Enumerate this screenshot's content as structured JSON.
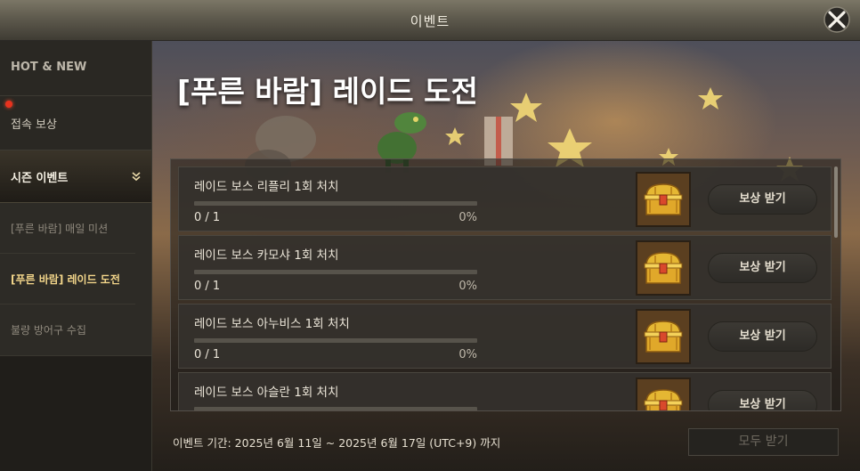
{
  "window": {
    "title": "이벤트"
  },
  "sidebar": {
    "hot_new": "HOT & NEW",
    "login_reward": "접속 보상",
    "season_event": "시즌 이벤트",
    "sub_items": [
      {
        "label": "[푸른 바람] 매일 미션",
        "active": false
      },
      {
        "label": "[푸른 바람] 레이드 도전",
        "active": true
      },
      {
        "label": "불량 방어구 수집",
        "active": false
      }
    ]
  },
  "main": {
    "title": "[푸른 바람] 레이드 도전",
    "missions": [
      {
        "title": "레이드 보스 리플리 1회 처치",
        "count": "0 / 1",
        "percent": "0%",
        "progress": 0,
        "button": "보상 받기"
      },
      {
        "title": "레이드 보스 카모샤 1회 처치",
        "count": "0 / 1",
        "percent": "0%",
        "progress": 0,
        "button": "보상 받기"
      },
      {
        "title": "레이드 보스 아누비스 1회 처치",
        "count": "0 / 1",
        "percent": "0%",
        "progress": 0,
        "button": "보상 받기"
      },
      {
        "title": "레이드 보스 아슬란 1회 처치",
        "count": "",
        "percent": "",
        "progress": 0,
        "button": "보상 받기"
      }
    ],
    "period": "이벤트 기간: 2025년 6월 11일 ~ 2025년 6월 17일 (UTC+9) 까지",
    "claim_all": "모두 받기"
  },
  "icons": {
    "close": "close-icon",
    "expand": "chevron-down-icon",
    "reward": "treasure-chest-icon"
  },
  "colors": {
    "active_sub": "#f2d58a",
    "notification_dot": "#e8321e",
    "progress_fill": "#d9b25a"
  }
}
